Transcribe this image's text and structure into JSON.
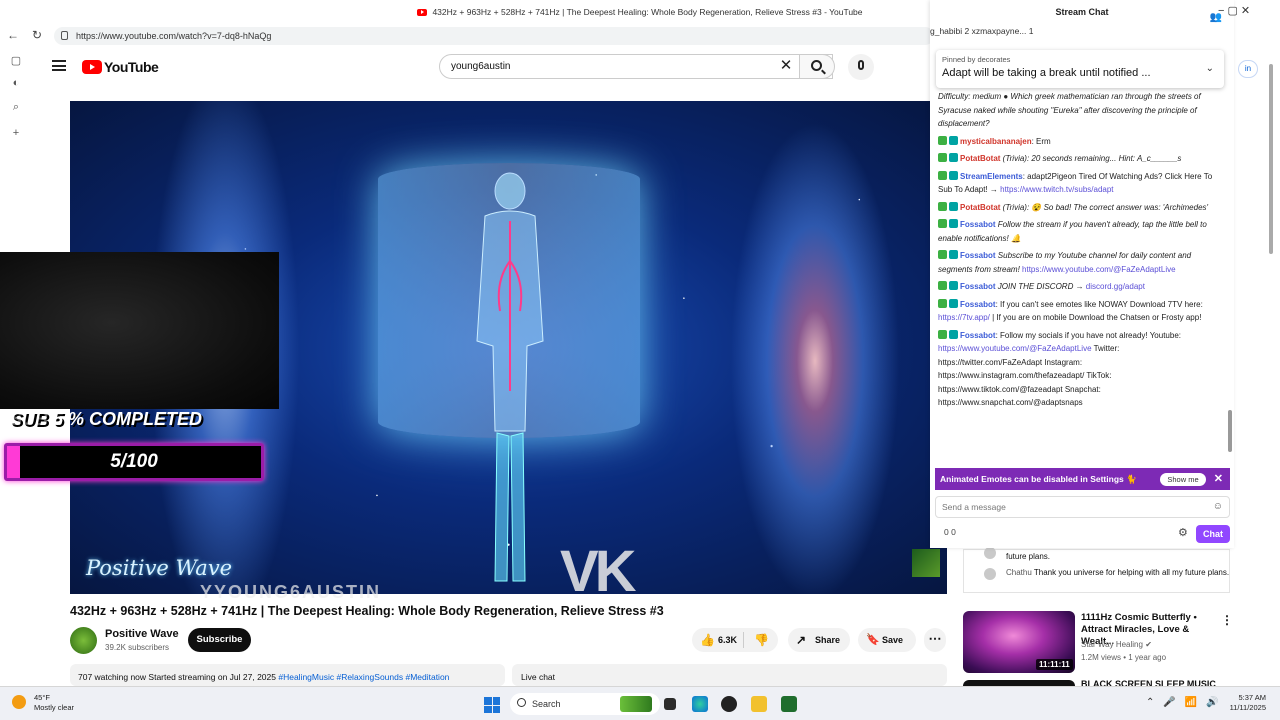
{
  "window": {
    "title": "432Hz + 963Hz + 528Hz + 741Hz | The Deepest Healing: Whole Body Regeneration, Relieve Stress #3 - YouTube",
    "controls": "−   ▢   ✕"
  },
  "browser": {
    "url": "https://www.youtube.com/watch?v=7-dq8-hNaQg"
  },
  "youtube": {
    "logo": "YouTube",
    "search_value": "young6austin",
    "sign_in": "in"
  },
  "video": {
    "overlay_goal_ghost": "SUB",
    "overlay_goal_text": "5 % COMPLETED",
    "overlay_goal_progress": 0.05,
    "overlay_goal_count": "5/100",
    "watermark_channel": "Positive Wave",
    "watermark_overlay": "YYOUNG6AUSTIN",
    "watermark_vk": "VK",
    "title": "432Hz + 963Hz + 528Hz + 741Hz | The Deepest Healing: Whole Body Regeneration, Relieve Stress #3",
    "channel_name": "Positive Wave",
    "channel_subs": "39.2K subscribers",
    "subscribe_label": "Subscribe",
    "likes": "6.3K",
    "share_label": "Share",
    "save_label": "Save",
    "more_label": "⋯",
    "watching": "707 watching now  Started streaming on Jul 27, 2025 ",
    "tags": "#HealingMusic #RelaxingSounds #Meditation",
    "live_chat_label": "Live chat"
  },
  "old_chat": [
    {
      "text": "future plans."
    },
    {
      "user": "Chathu",
      "text": "Thank you universe for helping with all my future plans."
    }
  ],
  "recommendations": [
    {
      "title": "1111Hz Cosmic Butterfly • Attract Miracles, Love & Wealt...",
      "channel": "Star Way Healing",
      "meta": "1.2M views • 1 year ago",
      "duration": "11:11:11"
    },
    {
      "title": "BLACK SCREEN SLEEP MUSIC"
    }
  ],
  "chat": {
    "header": "Stream Chat",
    "badges_row": "g_habibi   2   xzmaxpayne...   1",
    "pinned_by": "Pinned by  decorates",
    "pinned_text": "Adapt will be taking a break until notified ...",
    "messages": [
      {
        "user": "",
        "text": "Difficulty: medium ● Which greek mathematician ran through the streets of Syracuse naked while shouting \"Eureka\" after discovering the principle of displacement?",
        "style": "it"
      },
      {
        "user": "mysticalbananajen",
        "color": "#d0352b",
        "text": ": Erm"
      },
      {
        "user": "PotatBotat",
        "color": "#d0352b",
        "text": " (Trivia): 20 seconds remaining... Hint: A_c______s",
        "style": "it"
      },
      {
        "user": "StreamElements",
        "color": "#3b5bd6",
        "text": ": adapt2Pigeon Tired Of Watching Ads? Click Here To Sub To Adapt! → ",
        "link": "https://www.twitch.tv/subs/adapt"
      },
      {
        "user": "PotatBotat",
        "color": "#d0352b",
        "text": " (Trivia): 😵 So bad! The correct answer was: 'Archimedes'",
        "style": "it"
      },
      {
        "user": "Fossabot",
        "color": "#3b5bd6",
        "text": " Follow the stream if you haven't already, tap the little bell to enable notifications! 🔔",
        "style": "it"
      },
      {
        "user": "Fossabot",
        "color": "#3b5bd6",
        "text": " Subscribe to my Youtube channel for daily content and segments from stream! ",
        "link": "https://www.youtube.com/@FaZeAdaptLive",
        "style": "it"
      },
      {
        "user": "Fossabot",
        "color": "#3b5bd6",
        "text": " JOIN THE DISCORD → ",
        "link": "discord.gg/adapt",
        "style": "it"
      },
      {
        "user": "Fossabot",
        "color": "#3b5bd6",
        "text": ": If you can't see emotes like NOWAY Download 7TV here: ",
        "link": "https://7tv.app/",
        "text2": " | If you are on mobile Download the Chatsen or Frosty app!"
      },
      {
        "user": "Fossabot",
        "color": "#3b5bd6",
        "text": ": Follow my socials if you have not already! Youtube: ",
        "link": "https://www.youtube.com/@FaZeAdaptLive",
        "text2": " Twitter: https://twitter.com/FaZeAdapt Instagram: https://www.instagram.com/thefazeadapt/ TikTok: https://www.tiktok.com/@fazeadapt Snapchat: https://www.snapchat.com/@adaptsnaps"
      }
    ],
    "animated_notice": "Animated Emotes can be disabled in Settings 🐈",
    "show_me": "Show me",
    "send_placeholder": "Send a message",
    "points": "0   0",
    "chat_button": "Chat"
  },
  "taskbar": {
    "temp": "45°F",
    "condition": "Mostly clear",
    "search": "Search",
    "time": "5:37 AM",
    "date": "11/11/2025"
  },
  "colors": {
    "accent_red": "#ff0000",
    "twitch_purple": "#9147ff",
    "goal_pink": "#ff3ad6",
    "link_blue": "#065fd4"
  }
}
